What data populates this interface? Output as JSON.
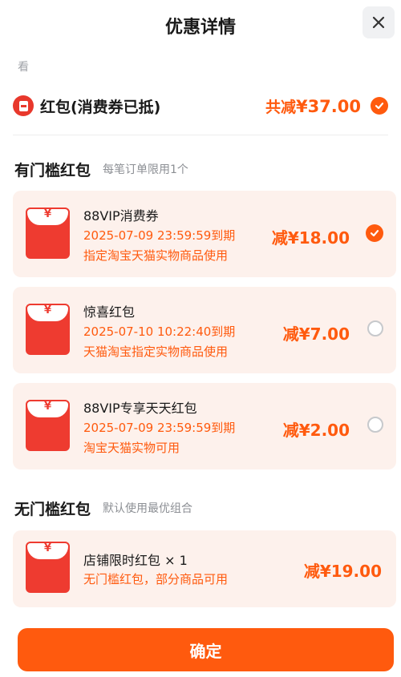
{
  "header": {
    "title": "优惠详情",
    "close_icon": "close-icon"
  },
  "hint": "看",
  "summary": {
    "label": "红包(消费券已抵)",
    "total_prefix": "共减",
    "total_amount": "¥37.00",
    "checked": true
  },
  "threshold_section": {
    "title": "有门槛红包",
    "subtitle": "每笔订单限用1个",
    "items": [
      {
        "name": "88VIP消费券",
        "expiry": "2025-07-09 23:59:59到期",
        "scope": "指定淘宝天猫实物商品使用",
        "amount_prefix": "减",
        "amount": "¥18.00",
        "selected": true
      },
      {
        "name": "惊喜红包",
        "expiry": "2025-07-10 10:22:40到期",
        "scope": "天猫淘宝指定实物商品使用",
        "amount_prefix": "减",
        "amount": "¥7.00",
        "selected": false
      },
      {
        "name": "88VIP专享天天红包",
        "expiry": "2025-07-09 23:59:59到期",
        "scope": "淘宝天猫实物可用",
        "amount_prefix": "减",
        "amount": "¥2.00",
        "selected": false
      }
    ]
  },
  "no_threshold_section": {
    "title": "无门槛红包",
    "subtitle": "默认使用最优组合",
    "items": [
      {
        "name": "店铺限时红包 × 1",
        "scope": "无门槛红包，部分商品可用",
        "amount_prefix": "减",
        "amount": "¥19.00"
      }
    ]
  },
  "envelope_symbol": "¥",
  "confirm_label": "确定",
  "colors": {
    "accent": "#ff5a0e",
    "envelope_red": "#ee3b30",
    "card_bg": "#fdf1ec"
  }
}
